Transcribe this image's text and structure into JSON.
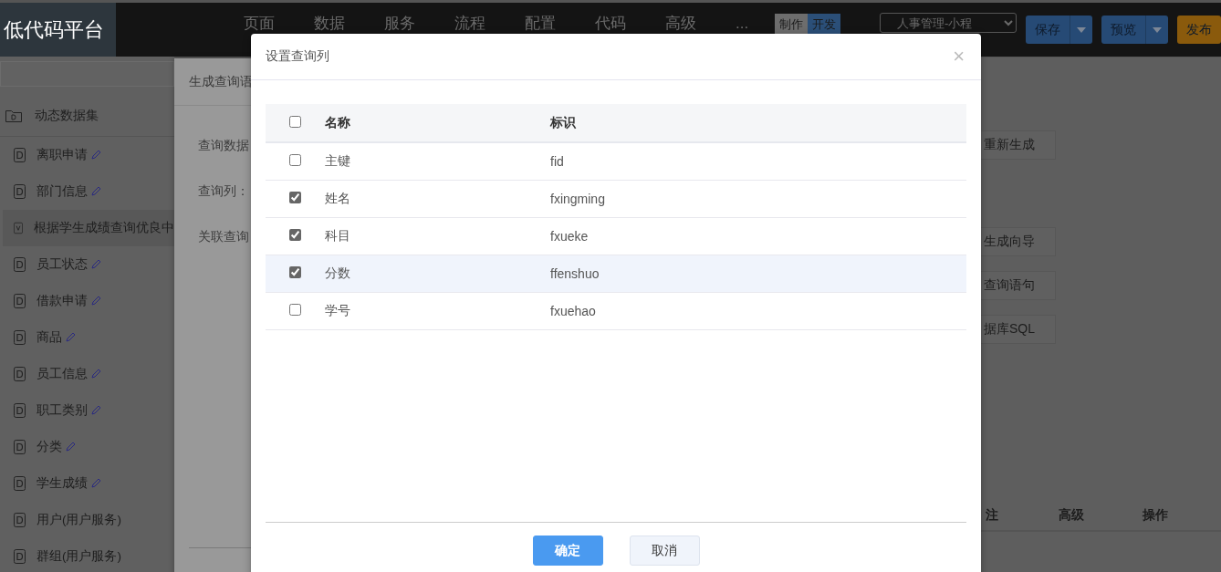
{
  "header": {
    "logo": "低代码平台",
    "nav": [
      "页面",
      "数据",
      "服务",
      "流程",
      "配置",
      "代码",
      "高级",
      "..."
    ],
    "mode_toggle": [
      {
        "label": "制作",
        "selected": false
      },
      {
        "label": "开发",
        "selected": true
      }
    ],
    "app_select": "人事管理-小程",
    "actions": [
      {
        "label": "保存",
        "kind": "split",
        "color": "#264a75"
      },
      {
        "label": "预览",
        "kind": "split",
        "color": "#264a75"
      },
      {
        "label": "发布",
        "kind": "plain",
        "color": "#8a5a0c"
      }
    ]
  },
  "sidebar": {
    "group": "动态数据集",
    "items": [
      {
        "label": "离职申请",
        "kind": "dataset",
        "editable": true,
        "selected": false
      },
      {
        "label": "部门信息",
        "kind": "dataset",
        "editable": true,
        "selected": false
      },
      {
        "label": "根据学生成绩查询优良中",
        "kind": "view",
        "editable": false,
        "selected": true
      },
      {
        "label": "员工状态",
        "kind": "dataset",
        "editable": true,
        "selected": false
      },
      {
        "label": "借款申请",
        "kind": "dataset",
        "editable": true,
        "selected": false
      },
      {
        "label": "商品",
        "kind": "dataset",
        "editable": true,
        "selected": false
      },
      {
        "label": "员工信息",
        "kind": "dataset",
        "editable": true,
        "selected": false
      },
      {
        "label": "职工类别",
        "kind": "dataset",
        "editable": true,
        "selected": false
      },
      {
        "label": "分类",
        "kind": "dataset",
        "editable": true,
        "selected": false
      },
      {
        "label": "学生成绩",
        "kind": "dataset",
        "editable": true,
        "selected": false
      },
      {
        "label": "用户(用户服务)",
        "kind": "dataset",
        "editable": false,
        "selected": false
      },
      {
        "label": "群组(用户服务)",
        "kind": "dataset",
        "editable": false,
        "selected": false
      }
    ]
  },
  "query_dialog": {
    "title": "生成查询语",
    "labels": [
      "查询数据",
      "查询列：",
      "关联查询"
    ]
  },
  "page": {
    "buttons": [
      "重新生成",
      "生成向导",
      "查询语句",
      "据库SQL"
    ],
    "table_columns": [
      "注",
      "高级",
      "操作"
    ]
  },
  "modal": {
    "title": "设置查询列",
    "close": "×",
    "select_all": false,
    "columns": [
      "名称",
      "标识"
    ],
    "rows": [
      {
        "name": "主键",
        "id": "fid",
        "checked": false,
        "hovered": false
      },
      {
        "name": "姓名",
        "id": "fxingming",
        "checked": true,
        "hovered": false
      },
      {
        "name": "科目",
        "id": "fxueke",
        "checked": true,
        "hovered": false
      },
      {
        "name": "分数",
        "id": "ffenshuo",
        "checked": true,
        "hovered": true
      },
      {
        "name": "学号",
        "id": "fxuehao",
        "checked": false,
        "hovered": false
      }
    ],
    "buttons": [
      {
        "label": "确定",
        "kind": "primary"
      },
      {
        "label": "取消",
        "kind": "secondary"
      }
    ]
  }
}
